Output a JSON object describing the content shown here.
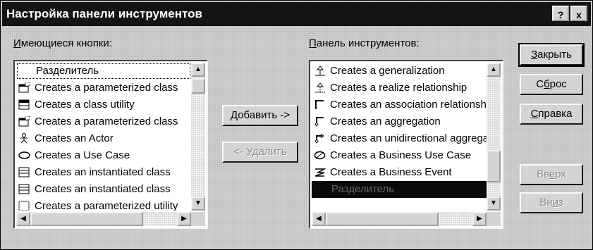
{
  "window": {
    "title": "Настройка панели инструментов",
    "help_button": "?",
    "close_button": "x"
  },
  "available": {
    "label_accel": "И",
    "label_rest": "меющиеся кнопки:",
    "items": [
      {
        "icon": "separator",
        "text": "Разделитель"
      },
      {
        "icon": "parameterized-class-icon",
        "text": "Creates a parameterized class"
      },
      {
        "icon": "class-utility-icon",
        "text": "Creates a class utility"
      },
      {
        "icon": "parameterized-class-icon",
        "text": "Creates a parameterized class"
      },
      {
        "icon": "actor-icon",
        "text": "Creates an Actor"
      },
      {
        "icon": "use-case-icon",
        "text": "Creates a Use Case"
      },
      {
        "icon": "instantiated-class-icon",
        "text": "Creates an instantiated class"
      },
      {
        "icon": "instantiated-class-icon",
        "text": "Creates an instantiated class"
      },
      {
        "icon": "utility-icon",
        "text": "Creates a parameterized utility"
      }
    ]
  },
  "toolbar": {
    "label_accel": "П",
    "label_rest": "анель инструментов:",
    "items": [
      {
        "icon": "generalization-icon",
        "text": "Creates a generalization"
      },
      {
        "icon": "realize-icon",
        "text": "Creates a realize relationship"
      },
      {
        "icon": "association-icon",
        "text": "Creates an association relationship"
      },
      {
        "icon": "aggregation-icon",
        "text": "Creates an aggregation"
      },
      {
        "icon": "unidirectional-aggregation-icon",
        "text": "Creates an unidirectional aggregation"
      },
      {
        "icon": "business-use-case-icon",
        "text": "Creates a Business Use Case"
      },
      {
        "icon": "business-event-icon",
        "text": "Creates a Business Event"
      },
      {
        "icon": "separator",
        "text": "Разделитель"
      }
    ]
  },
  "buttons": {
    "add": {
      "accel": "Д",
      "rest": "обавить ->"
    },
    "remove": {
      "pre": "<- ",
      "accel": "У",
      "rest": "далить"
    },
    "close": {
      "accel": "З",
      "rest": "акрыть"
    },
    "reset": {
      "pre": "С",
      "accel": "б",
      "rest": "рос"
    },
    "help": {
      "accel": "С",
      "rest": "правка"
    },
    "up": {
      "pre": "Вв",
      "accel": "е",
      "rest": "рх"
    },
    "down": {
      "pre": "Вн",
      "accel": "и",
      "rest": "з"
    }
  }
}
